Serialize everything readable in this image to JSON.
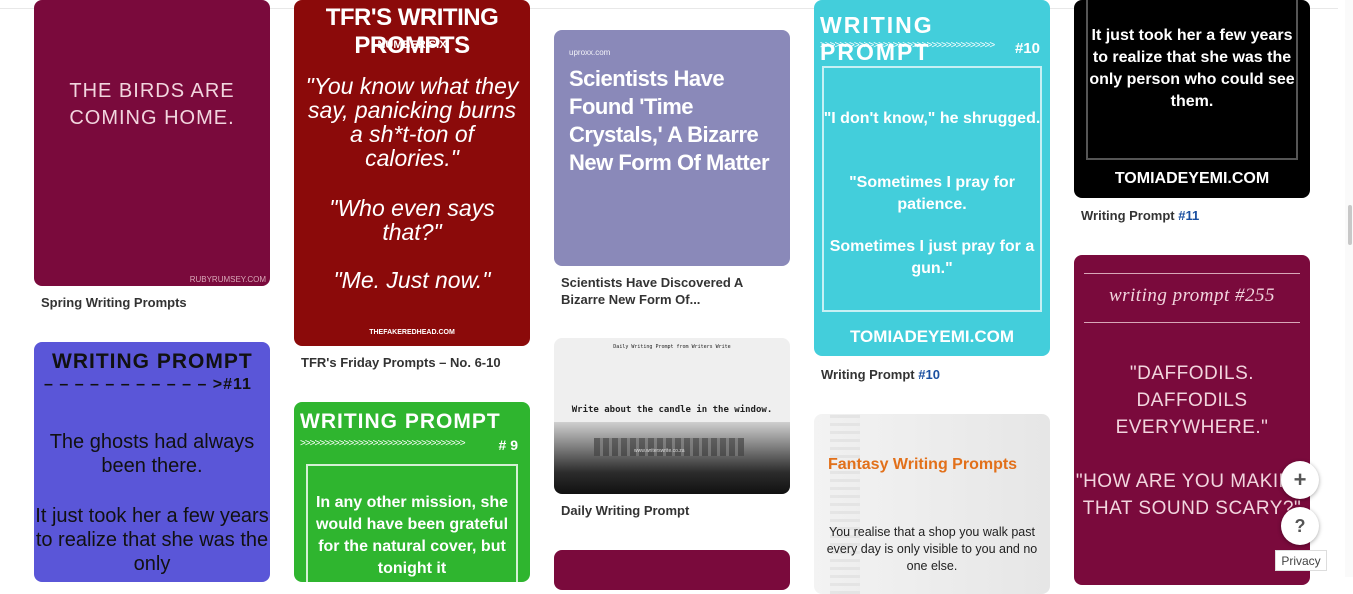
{
  "pins": [
    {
      "id": "p1",
      "lines": [
        "THE BIRDS ARE",
        "COMING HOME."
      ],
      "credit": "RUBYRUMSEY.COM",
      "caption": "Spring Writing Prompts"
    },
    {
      "id": "p2",
      "heading": "TFR'S WRITING PROMPTS",
      "subheading": "NUMBER SIX",
      "quote1": "\"You know what they say, panicking burns a sh*t-ton of calories.\"",
      "quote2": "\"Who even says that?\"",
      "quote3": "\"Me. Just now.\"",
      "credit": "THEFAKEREDHEAD.COM",
      "caption": "TFR's Friday Prompts – No. 6-10"
    },
    {
      "id": "p3",
      "source": "uproxx.com",
      "headline": "Scientists Have Found 'Time Crystals,' A Bizarre New Form Of Matter",
      "caption_lines": [
        "Scientists Have Discovered A",
        "Bizarre New Form Of..."
      ]
    },
    {
      "id": "p4",
      "heading": "WRITING PROMPT",
      "arrows": ">>>>>>>>>>>>>>>>>>>>>>>>>>>>>>>>>>>>",
      "number": "#10",
      "text1": "\"I don't know,\" he shrugged.",
      "text2": "\"Sometimes I pray for patience.",
      "text3": "Sometimes I just pray for a gun.\"",
      "site": "TOMIADEYEMI.COM",
      "caption_prefix": "Writing Prompt ",
      "caption_num": "#10"
    },
    {
      "id": "p5",
      "text": "It just took her a few years to realize that she was the only person who could see them.",
      "site": "TOMIADEYEMI.COM",
      "caption_prefix": "Writing Prompt ",
      "caption_num": "#11"
    },
    {
      "id": "p6",
      "heading": "WRITING PROMPT",
      "dashes": "– – – – – – – – – – – >#11",
      "text1": "The ghosts had always been there.",
      "text2": "It just took her a few years to realize that she was the only"
    },
    {
      "id": "p7",
      "heading": "WRITING PROMPT",
      "arrows": ">>>>>>>>>>>>>>>>>>>>>>>>>>>>>>>>>>",
      "number": "# 9",
      "text": "In any other mission, she would have been grateful for the natural cover, but tonight it"
    },
    {
      "id": "p8",
      "header": "Daily Writing Prompt from Writers Write",
      "text": "Write about the candle in the window.",
      "site": "www.writerswrite.co.za",
      "caption": "Daily Writing Prompt"
    },
    {
      "id": "p10",
      "heading": "Fantasy Writing Prompts",
      "text": "You realise that a shop you walk past every day is only visible to you and no one else."
    },
    {
      "id": "p11",
      "heading": "writing prompt #255",
      "text1": "\"DAFFODILS. DAFFODILS EVERYWHERE.\"",
      "text2": "\"HOW ARE YOU MAKING THAT SOUND SCARY?\""
    }
  ],
  "controls": {
    "add": "+",
    "help": "?",
    "privacy": "Privacy"
  },
  "colors": {
    "maroon": "#7a0a3c",
    "red": "#8b0a0a",
    "lavender": "#8a89b9",
    "cyan": "#43cedb",
    "indigo": "#5a56d8",
    "green": "#2fb52f",
    "link": "#1a4fa0"
  }
}
